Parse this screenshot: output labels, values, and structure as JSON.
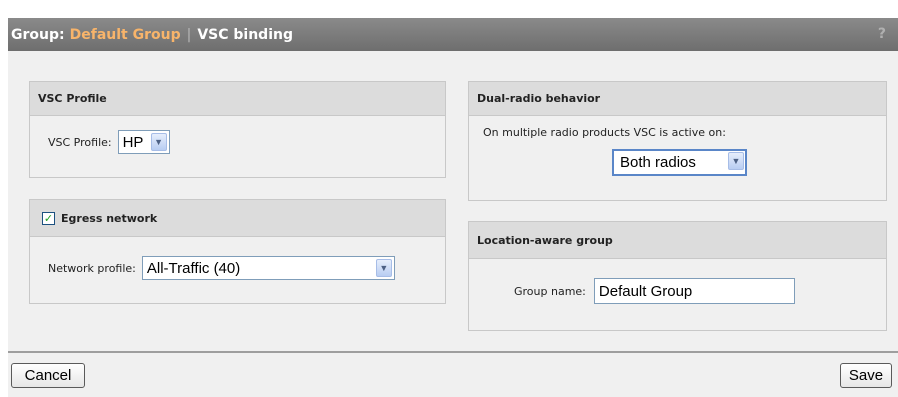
{
  "header": {
    "prefix": "Group:",
    "group_name": "Default Group",
    "separator": "|",
    "title": "VSC binding",
    "help": "?"
  },
  "vsc_profile": {
    "heading": "VSC Profile",
    "label": "VSC Profile:",
    "value": "HP"
  },
  "egress": {
    "heading": "Egress network",
    "checked": true,
    "label": "Network profile:",
    "value": "All-Traffic (40)"
  },
  "dual_radio": {
    "heading": "Dual-radio behavior",
    "description": "On multiple radio products VSC is active on:",
    "value": "Both radios"
  },
  "location": {
    "heading": "Location-aware group",
    "label": "Group name:",
    "value": "Default Group"
  },
  "footer": {
    "cancel": "Cancel",
    "save": "Save"
  },
  "icons": {
    "dropdown": "chevron-down-icon",
    "checkmark": "checkmark-icon",
    "help": "help-icon"
  },
  "colors": {
    "header_bg": "#7a7a7a",
    "accent": "#f8b46a",
    "check": "#21a121"
  }
}
